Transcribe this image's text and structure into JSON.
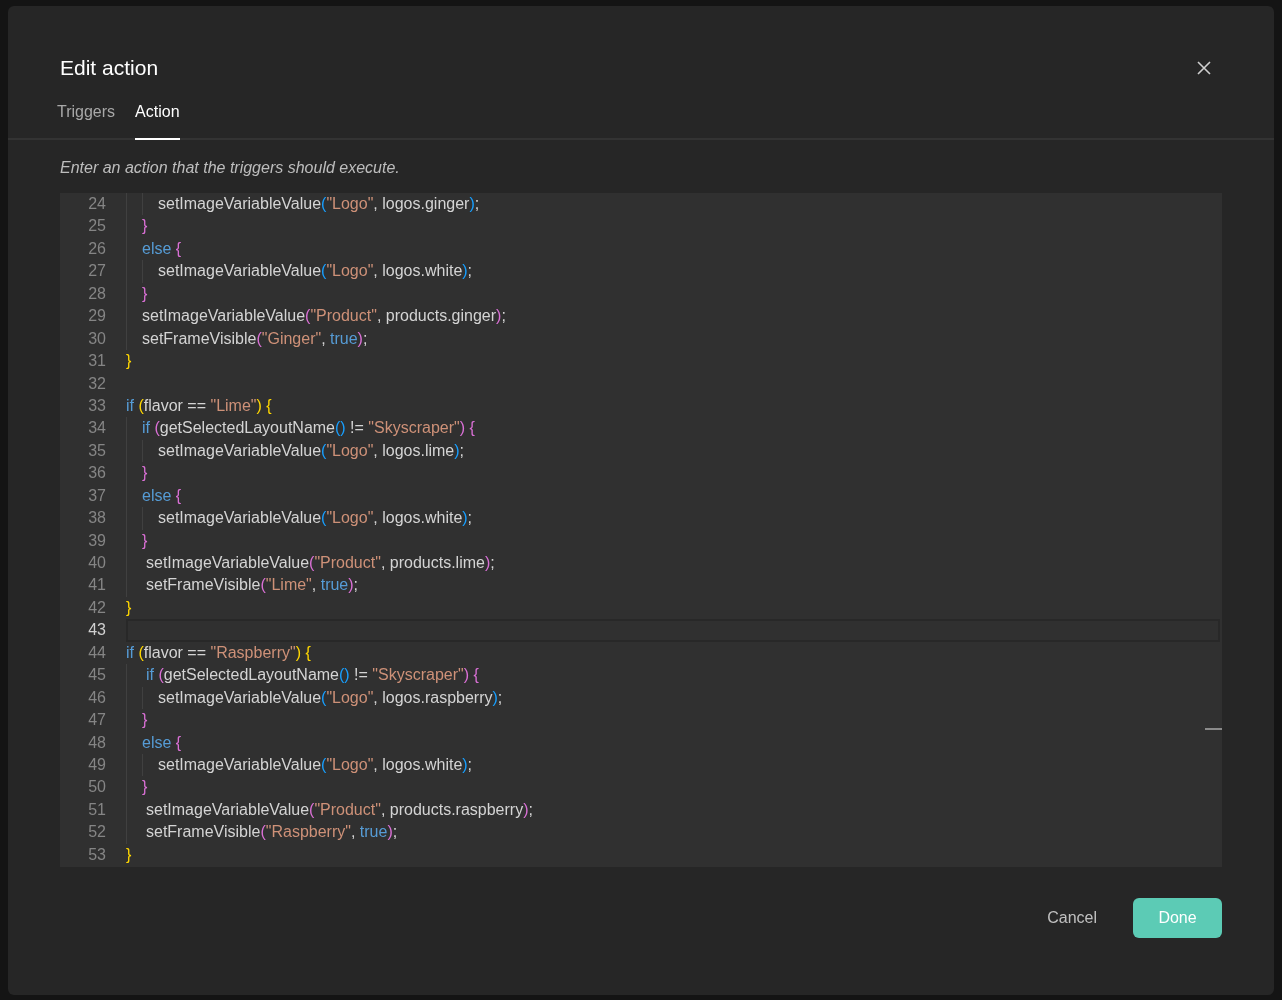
{
  "dialog": {
    "title": "Edit action",
    "tabs": [
      {
        "label": "Triggers",
        "selected": false
      },
      {
        "label": "Action",
        "selected": true
      }
    ],
    "hint": "Enter an action that the triggers should execute.",
    "editor": {
      "lines": [
        {
          "number": "24",
          "current": false,
          "tokens": [
            {
              "kind": "indent"
            },
            {
              "kind": "indent"
            },
            {
              "kind": "plain",
              "text": "setImageVariableValue"
            },
            {
              "kind": "brace3",
              "text": "("
            },
            {
              "kind": "string",
              "text": "\"Logo\""
            },
            {
              "kind": "plain",
              "text": ", logos.ginger"
            },
            {
              "kind": "brace3",
              "text": ")"
            },
            {
              "kind": "plain",
              "text": ";"
            }
          ]
        },
        {
          "number": "25",
          "current": false,
          "tokens": [
            {
              "kind": "indent"
            },
            {
              "kind": "brace2",
              "text": "}"
            }
          ]
        },
        {
          "number": "26",
          "current": false,
          "tokens": [
            {
              "kind": "indent"
            },
            {
              "kind": "keyword",
              "text": "else"
            },
            {
              "kind": "brace2",
              "text": " {"
            }
          ]
        },
        {
          "number": "27",
          "current": false,
          "tokens": [
            {
              "kind": "indent"
            },
            {
              "kind": "indent"
            },
            {
              "kind": "plain",
              "text": "setImageVariableValue"
            },
            {
              "kind": "brace3",
              "text": "("
            },
            {
              "kind": "string",
              "text": "\"Logo\""
            },
            {
              "kind": "plain",
              "text": ", logos.white"
            },
            {
              "kind": "brace3",
              "text": ")"
            },
            {
              "kind": "plain",
              "text": ";"
            }
          ]
        },
        {
          "number": "28",
          "current": false,
          "tokens": [
            {
              "kind": "indent"
            },
            {
              "kind": "brace2",
              "text": "}"
            }
          ]
        },
        {
          "number": "29",
          "current": false,
          "tokens": [
            {
              "kind": "indent"
            },
            {
              "kind": "plain",
              "text": "setImageVariableValue"
            },
            {
              "kind": "brace2",
              "text": "("
            },
            {
              "kind": "string",
              "text": "\"Product\""
            },
            {
              "kind": "plain",
              "text": ", products.ginger"
            },
            {
              "kind": "brace2",
              "text": ")"
            },
            {
              "kind": "plain",
              "text": ";"
            }
          ]
        },
        {
          "number": "30",
          "current": false,
          "tokens": [
            {
              "kind": "indent"
            },
            {
              "kind": "plain",
              "text": "setFrameVisible"
            },
            {
              "kind": "brace2",
              "text": "("
            },
            {
              "kind": "string",
              "text": "\"Ginger\""
            },
            {
              "kind": "plain",
              "text": ", "
            },
            {
              "kind": "keyword",
              "text": "true"
            },
            {
              "kind": "brace2",
              "text": ")"
            },
            {
              "kind": "plain",
              "text": ";"
            }
          ]
        },
        {
          "number": "31",
          "current": false,
          "tokens": [
            {
              "kind": "brace1",
              "text": "}"
            }
          ]
        },
        {
          "number": "32",
          "current": false
        },
        {
          "number": "33",
          "current": false,
          "tokens": [
            {
              "kind": "keyword",
              "text": "if"
            },
            {
              "kind": "brace1",
              "text": " ("
            },
            {
              "kind": "plain",
              "text": "flavor == "
            },
            {
              "kind": "string",
              "text": "\"Lime\""
            },
            {
              "kind": "brace1",
              "text": ")"
            },
            {
              "kind": "brace1",
              "text": " {"
            }
          ]
        },
        {
          "number": "34",
          "current": false,
          "tokens": [
            {
              "kind": "indent"
            },
            {
              "kind": "keyword",
              "text": "if"
            },
            {
              "kind": "brace2",
              "text": " ("
            },
            {
              "kind": "plain",
              "text": "getSelectedLayoutName"
            },
            {
              "kind": "brace3",
              "text": "()"
            },
            {
              "kind": "plain",
              "text": " != "
            },
            {
              "kind": "string",
              "text": "\"Skyscraper\""
            },
            {
              "kind": "brace2",
              "text": ")"
            },
            {
              "kind": "brace2",
              "text": " {"
            }
          ]
        },
        {
          "number": "35",
          "current": false,
          "tokens": [
            {
              "kind": "indent"
            },
            {
              "kind": "indent"
            },
            {
              "kind": "plain",
              "text": "setImageVariableValue"
            },
            {
              "kind": "brace3",
              "text": "("
            },
            {
              "kind": "string",
              "text": "\"Logo\""
            },
            {
              "kind": "plain",
              "text": ", logos.lime"
            },
            {
              "kind": "brace3",
              "text": ")"
            },
            {
              "kind": "plain",
              "text": ";"
            }
          ]
        },
        {
          "number": "36",
          "current": false,
          "tokens": [
            {
              "kind": "indent"
            },
            {
              "kind": "brace2",
              "text": "}"
            }
          ]
        },
        {
          "number": "37",
          "current": false,
          "tokens": [
            {
              "kind": "indent"
            },
            {
              "kind": "keyword",
              "text": "else"
            },
            {
              "kind": "brace2",
              "text": " {"
            }
          ]
        },
        {
          "number": "38",
          "current": false,
          "tokens": [
            {
              "kind": "indent"
            },
            {
              "kind": "indent"
            },
            {
              "kind": "plain",
              "text": "setImageVariableValue"
            },
            {
              "kind": "brace3",
              "text": "("
            },
            {
              "kind": "string",
              "text": "\"Logo\""
            },
            {
              "kind": "plain",
              "text": ", logos.white"
            },
            {
              "kind": "brace3",
              "text": ")"
            },
            {
              "kind": "plain",
              "text": ";"
            }
          ]
        },
        {
          "number": "39",
          "current": false,
          "tokens": [
            {
              "kind": "indent"
            },
            {
              "kind": "brace2",
              "text": "}"
            }
          ]
        },
        {
          "number": "40",
          "current": false,
          "tokens": [
            {
              "kind": "wideindent"
            },
            {
              "kind": "plain",
              "text": "setImageVariableValue"
            },
            {
              "kind": "brace2",
              "text": "("
            },
            {
              "kind": "string",
              "text": "\"Product\""
            },
            {
              "kind": "plain",
              "text": ", products.lime"
            },
            {
              "kind": "brace2",
              "text": ")"
            },
            {
              "kind": "plain",
              "text": ";"
            }
          ]
        },
        {
          "number": "41",
          "current": false,
          "tokens": [
            {
              "kind": "wideindent"
            },
            {
              "kind": "plain",
              "text": "setFrameVisible"
            },
            {
              "kind": "brace2",
              "text": "("
            },
            {
              "kind": "string",
              "text": "\"Lime\""
            },
            {
              "kind": "plain",
              "text": ", "
            },
            {
              "kind": "keyword",
              "text": "true"
            },
            {
              "kind": "brace2",
              "text": ")"
            },
            {
              "kind": "plain",
              "text": ";"
            }
          ]
        },
        {
          "number": "42",
          "current": false,
          "tokens": [
            {
              "kind": "brace1",
              "text": "}"
            }
          ]
        },
        {
          "number": "43",
          "current": true
        },
        {
          "number": "44",
          "current": false,
          "tokens": [
            {
              "kind": "keyword",
              "text": "if"
            },
            {
              "kind": "brace1",
              "text": " ("
            },
            {
              "kind": "plain",
              "text": "flavor == "
            },
            {
              "kind": "string",
              "text": "\"Raspberry\""
            },
            {
              "kind": "brace1",
              "text": ")"
            },
            {
              "kind": "brace1",
              "text": " {"
            }
          ]
        },
        {
          "number": "45",
          "current": false,
          "tokens": [
            {
              "kind": "wideindent"
            },
            {
              "kind": "keyword",
              "text": "if"
            },
            {
              "kind": "brace2",
              "text": " ("
            },
            {
              "kind": "plain",
              "text": "getSelectedLayoutName"
            },
            {
              "kind": "brace3",
              "text": "()"
            },
            {
              "kind": "plain",
              "text": " != "
            },
            {
              "kind": "string",
              "text": "\"Skyscraper\""
            },
            {
              "kind": "brace2",
              "text": ")"
            },
            {
              "kind": "brace2",
              "text": " {"
            }
          ]
        },
        {
          "number": "46",
          "current": false,
          "tokens": [
            {
              "kind": "indent"
            },
            {
              "kind": "indent"
            },
            {
              "kind": "plain",
              "text": "setImageVariableValue"
            },
            {
              "kind": "brace3",
              "text": "("
            },
            {
              "kind": "string",
              "text": "\"Logo\""
            },
            {
              "kind": "plain",
              "text": ", logos.raspberry"
            },
            {
              "kind": "brace3",
              "text": ")"
            },
            {
              "kind": "plain",
              "text": ";"
            }
          ]
        },
        {
          "number": "47",
          "current": false,
          "tokens": [
            {
              "kind": "indent"
            },
            {
              "kind": "brace2",
              "text": "}"
            }
          ]
        },
        {
          "number": "48",
          "current": false,
          "tokens": [
            {
              "kind": "indent"
            },
            {
              "kind": "keyword",
              "text": "else"
            },
            {
              "kind": "brace2",
              "text": " {"
            }
          ]
        },
        {
          "number": "49",
          "current": false,
          "tokens": [
            {
              "kind": "indent"
            },
            {
              "kind": "indent"
            },
            {
              "kind": "plain",
              "text": "setImageVariableValue"
            },
            {
              "kind": "brace3",
              "text": "("
            },
            {
              "kind": "string",
              "text": "\"Logo\""
            },
            {
              "kind": "plain",
              "text": ", logos.white"
            },
            {
              "kind": "brace3",
              "text": ")"
            },
            {
              "kind": "plain",
              "text": ";"
            }
          ]
        },
        {
          "number": "50",
          "current": false,
          "tokens": [
            {
              "kind": "indent"
            },
            {
              "kind": "brace2",
              "text": "}"
            }
          ]
        },
        {
          "number": "51",
          "current": false,
          "tokens": [
            {
              "kind": "wideindent"
            },
            {
              "kind": "plain",
              "text": "setImageVariableValue"
            },
            {
              "kind": "brace2",
              "text": "("
            },
            {
              "kind": "string",
              "text": "\"Product\""
            },
            {
              "kind": "plain",
              "text": ", products.raspberry"
            },
            {
              "kind": "brace2",
              "text": ")"
            },
            {
              "kind": "plain",
              "text": ";"
            }
          ]
        },
        {
          "number": "52",
          "current": false,
          "tokens": [
            {
              "kind": "wideindent"
            },
            {
              "kind": "plain",
              "text": "setFrameVisible"
            },
            {
              "kind": "brace2",
              "text": "("
            },
            {
              "kind": "string",
              "text": "\"Raspberry\""
            },
            {
              "kind": "plain",
              "text": ", "
            },
            {
              "kind": "keyword",
              "text": "true"
            },
            {
              "kind": "brace2",
              "text": ")"
            },
            {
              "kind": "plain",
              "text": ";"
            }
          ]
        },
        {
          "number": "53",
          "current": false,
          "tokens": [
            {
              "kind": "brace1",
              "text": "}"
            }
          ]
        }
      ]
    },
    "buttons": [
      {
        "label": "Cancel",
        "kind": "text"
      },
      {
        "label": "Done",
        "kind": "primary"
      }
    ]
  }
}
